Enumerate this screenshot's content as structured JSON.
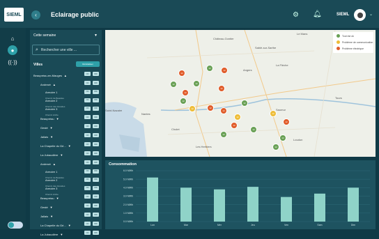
{
  "header": {
    "logo": "SIEML",
    "title": "Eclairage public",
    "user": "SIEML"
  },
  "panel": {
    "period": "Cette semaine",
    "search_placeholder": "Rechercher une ville ...",
    "villes_label": "Villes",
    "reset_label": "Réinitialiser",
    "btn_on": "ON",
    "btn_off": "OFF",
    "rows": [
      {
        "label": "Beaupréau-en-Mauges",
        "arrow": "▲",
        "indent": 0,
        "buttons": true
      },
      {
        "label": "Andrezé",
        "arrow": "▲",
        "indent": 1,
        "buttons": true
      },
      {
        "label": "Armoire 1",
        "sub": "Chemin de Beaulieu",
        "indent": 2,
        "buttons": true
      },
      {
        "label": "Armoire 2",
        "sub": "Chemin des Grandes",
        "indent": 2,
        "buttons": true
      },
      {
        "label": "Armoire 3",
        "sub": "Chemin Arche",
        "indent": 2,
        "buttons": true
      },
      {
        "label": "Beaupréau",
        "arrow": "▼",
        "indent": 1,
        "buttons": true
      },
      {
        "label": "Gesté",
        "arrow": "▼",
        "indent": 1,
        "buttons": true
      },
      {
        "label": "Jallais",
        "arrow": "▼",
        "indent": 1,
        "buttons": true
      },
      {
        "label": "La Chapelle du Gé...",
        "arrow": "▼",
        "indent": 1,
        "buttons": true
      },
      {
        "label": "La Jubaudière",
        "arrow": "▼",
        "indent": 1,
        "buttons": true
      },
      {
        "label": "Andrezé",
        "arrow": "▲",
        "indent": 1,
        "buttons": true
      },
      {
        "label": "Armoire 1",
        "sub": "Chemin de Beaulieu",
        "indent": 2,
        "buttons": true
      },
      {
        "label": "Armoire 2",
        "sub": "Chemin des Grandes",
        "indent": 2,
        "buttons": true
      },
      {
        "label": "Armoire 3",
        "sub": "Chemin Arche",
        "indent": 2,
        "buttons": true
      },
      {
        "label": "Beaupréau",
        "arrow": "▼",
        "indent": 1,
        "buttons": true
      },
      {
        "label": "Gesté",
        "arrow": "▼",
        "indent": 1,
        "buttons": true
      },
      {
        "label": "Jallais",
        "arrow": "▼",
        "indent": 1,
        "buttons": true
      },
      {
        "label": "La Chapelle du Gé...",
        "arrow": "▼",
        "indent": 1,
        "buttons": true
      },
      {
        "label": "La Jubaudière",
        "arrow": "▼",
        "indent": 1,
        "buttons": true
      }
    ]
  },
  "map": {
    "legend": [
      {
        "label": "Tout est ok",
        "color": "#69a055"
      },
      {
        "label": "Problème de communication",
        "color": "#eebd38"
      },
      {
        "label": "Problème électrique",
        "color": "#e05c2a"
      }
    ],
    "cities": [
      "Le Mans",
      "Château-Gontier",
      "Sablé-sur-Sarthe",
      "La Flèche",
      "Angers",
      "Saint-Nazaire",
      "Nantes",
      "Saumur",
      "Tours",
      "Cholet",
      "Loudun",
      "Les Herbiers"
    ],
    "markers": [
      {
        "n": "12",
        "s": "orange"
      },
      {
        "n": "12",
        "s": "green"
      },
      {
        "n": "12",
        "s": "green"
      },
      {
        "n": "12",
        "s": "orange"
      },
      {
        "n": "12",
        "s": "green"
      },
      {
        "n": "12",
        "s": "orange"
      },
      {
        "n": "12",
        "s": "green"
      },
      {
        "n": "12",
        "s": "yellow"
      },
      {
        "n": "12",
        "s": "orange"
      },
      {
        "n": "12",
        "s": "orange"
      },
      {
        "n": "12",
        "s": "orange"
      },
      {
        "n": "12",
        "s": "green"
      },
      {
        "n": "12",
        "s": "yellow"
      },
      {
        "n": "12",
        "s": "orange"
      },
      {
        "n": "12",
        "s": "green"
      },
      {
        "n": "12",
        "s": "green"
      },
      {
        "n": "12",
        "s": "yellow"
      },
      {
        "n": "12",
        "s": "orange"
      },
      {
        "n": "12",
        "s": "green"
      },
      {
        "n": "12",
        "s": "green"
      }
    ]
  },
  "chart_data": {
    "type": "bar",
    "title": "Consommation",
    "categories": [
      "Lun",
      "Mar",
      "Mer",
      "Jeu",
      "Ven",
      "Sam",
      "Dim"
    ],
    "values": [
      5.2,
      4.0,
      3.8,
      4.1,
      2.9,
      3.3,
      4.0
    ],
    "yticks": [
      "6.0 MWh",
      "5.0 MWh",
      "4.0 MWh",
      "3.0 MWh",
      "2.0 MWh",
      "1.0 MWh",
      "0.0 MWh"
    ],
    "ylim": [
      0,
      6
    ],
    "bar_color": "#8fd3c8"
  }
}
